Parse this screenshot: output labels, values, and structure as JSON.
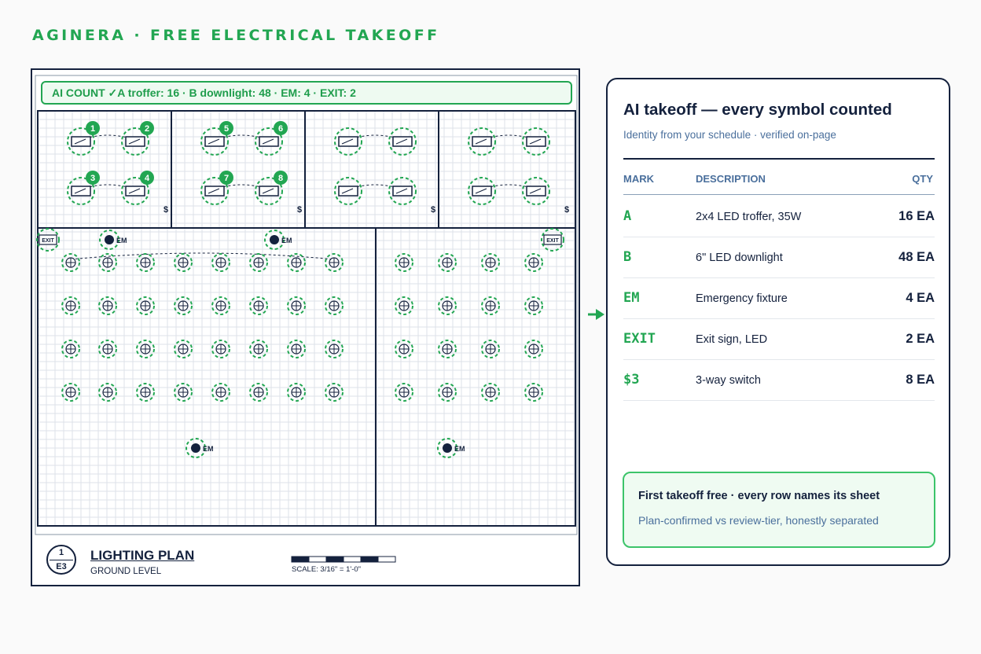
{
  "header": {
    "brand": "AGINERA · FREE ELECTRICAL TAKEOFF"
  },
  "sheet": {
    "ai_banner": "AI COUNT ✓A troffer: 16 · B downlight: 48 · EM: 4 · EXIT: 2",
    "labels": {
      "em": "EM",
      "exit": "EXIT",
      "switch": "$"
    },
    "troffer_numbers": [
      "1",
      "2",
      "3",
      "4",
      "5",
      "6",
      "7",
      "8"
    ],
    "title_block": {
      "sheet_number": "1",
      "sheet_ref": "E3",
      "title": "LIGHTING PLAN",
      "subtitle": "GROUND LEVEL",
      "scale": "SCALE: 3/16\" = 1'-0\""
    }
  },
  "panel": {
    "title": "AI takeoff — every symbol counted",
    "subtitle": "Identity from your schedule · verified on-page",
    "columns": {
      "mark": "MARK",
      "description": "DESCRIPTION",
      "qty": "QTY"
    },
    "rows": [
      {
        "mark": "A",
        "description": "2x4 LED troffer, 35W",
        "qty": "16 EA"
      },
      {
        "mark": "B",
        "description": "6\" LED downlight",
        "qty": "48 EA"
      },
      {
        "mark": "EM",
        "description": "Emergency fixture",
        "qty": "4 EA"
      },
      {
        "mark": "EXIT",
        "description": "Exit sign, LED",
        "qty": "2 EA"
      },
      {
        "mark": "$3",
        "description": "3-way switch",
        "qty": "8 EA"
      }
    ],
    "note": {
      "title": "First takeoff free · every row names its sheet",
      "subtitle": "Plan-confirmed vs review-tier, honestly separated"
    }
  },
  "colors": {
    "accent": "#22a652",
    "ink": "#14213d",
    "muted": "#4a6f9c",
    "grid": "#dde2e8"
  },
  "icons": [
    "arrow-right-icon",
    "troffer-icon",
    "downlight-icon",
    "em-fixture-icon",
    "exit-sign-icon",
    "switch-icon"
  ]
}
